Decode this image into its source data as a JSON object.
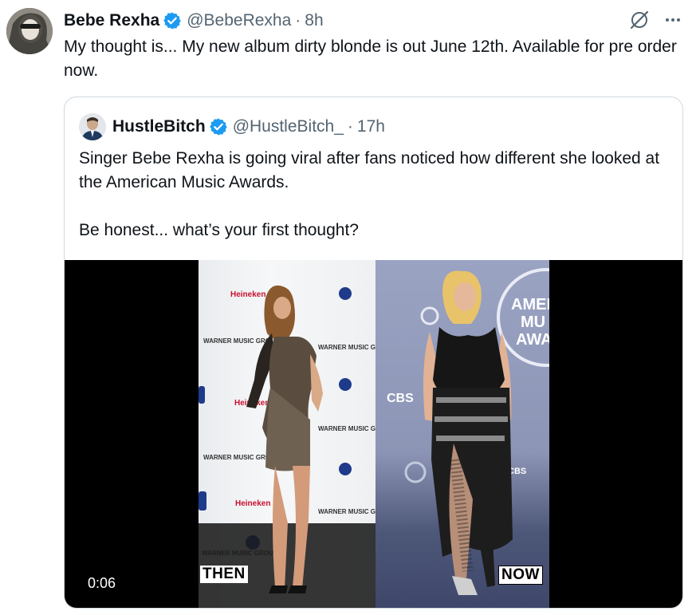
{
  "tweet": {
    "author_name": "Bebe Rexha",
    "author_handle": "@BebeRexha",
    "separator": "·",
    "time": "8h",
    "text": "My thought is... My new album dirty blonde is out June 12th. Available for pre order now."
  },
  "icons": {
    "verified": "verified-badge-icon",
    "grok": "grok-icon",
    "more": "more-icon"
  },
  "colors": {
    "verified_blue": "#1d9bf0",
    "text_primary": "#0f1419",
    "text_secondary": "#536471",
    "border": "#cfd9de"
  },
  "quote": {
    "author_name": "HustleBitch",
    "author_handle": "@HustleBitch_",
    "separator": "·",
    "time": "17h",
    "text_line1": "Singer Bebe Rexha is going viral after fans noticed how different she looked at the American Music Awards.",
    "text_line2": "Be honest... what’s your first thought?"
  },
  "media": {
    "duration": "0:06",
    "caption_left": "THEN",
    "caption_right": "NOW",
    "sign_amas": [
      "AMER",
      "MU",
      "AWA"
    ],
    "sign_cbs": "CBS",
    "sign_heineken": "Heineken",
    "sign_warner": "WARNER MUSIC GROUP"
  }
}
